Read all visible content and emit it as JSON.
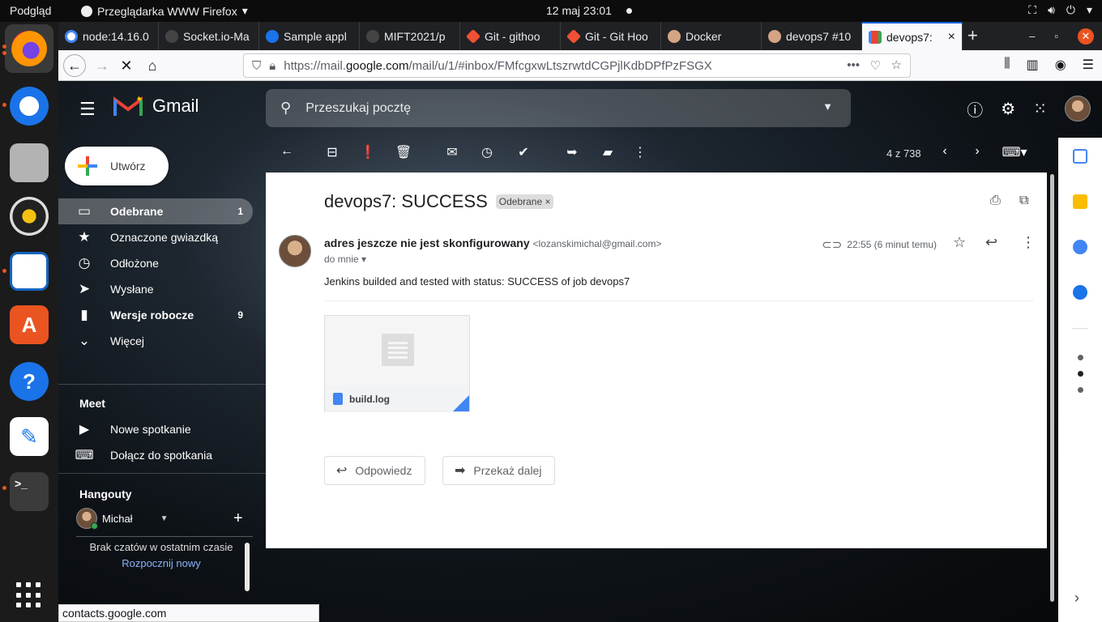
{
  "system": {
    "activity_label": "Podgląd",
    "app_name": "Przeglądarka WWW Firefox",
    "clock": "12 maj  23:01"
  },
  "dock": {
    "items": [
      "firefox",
      "thunderbird",
      "files",
      "rhythmbox",
      "libreoffice-writer",
      "software",
      "help",
      "text-editor",
      "terminal"
    ]
  },
  "browser": {
    "tabs": [
      {
        "title": "node:14.16.0",
        "icon": "google-icon"
      },
      {
        "title": "Socket.io-Ma",
        "icon": "github-icon"
      },
      {
        "title": "Sample appl",
        "icon": "circle-icon"
      },
      {
        "title": "MIFT2021/p",
        "icon": "github-icon"
      },
      {
        "title": "Git - githoo",
        "icon": "git-icon"
      },
      {
        "title": "Git - Git Hoo",
        "icon": "git-icon"
      },
      {
        "title": "Docker",
        "icon": "jenkins-icon"
      },
      {
        "title": "devops7 #10",
        "icon": "jenkins-icon"
      },
      {
        "title": "devops7: ",
        "icon": "gmail-icon"
      }
    ],
    "url_prefix": "https://mail.",
    "url_domain": "google.com",
    "url_path": "/mail/u/1/#inbox/FMfcgxwLtszrwtdCGPjlKdbDPfPzFSGX",
    "status_text": "contacts.google.com"
  },
  "gmail": {
    "logo_text": "Gmail",
    "search_placeholder": "Przeszukaj pocztę",
    "compose_label": "Utwórz",
    "nav": [
      {
        "label": "Odebrane",
        "count": "1",
        "icon": "inbox-icon",
        "active": true
      },
      {
        "label": "Oznaczone gwiazdką",
        "count": "",
        "icon": "star-icon",
        "active": false
      },
      {
        "label": "Odłożone",
        "count": "",
        "icon": "clock-icon",
        "active": false
      },
      {
        "label": "Wysłane",
        "count": "",
        "icon": "send-icon",
        "active": false
      },
      {
        "label": "Wersje robocze",
        "count": "9",
        "icon": "draft-icon",
        "active": false
      },
      {
        "label": "Więcej",
        "count": "",
        "icon": "chevron-down-icon",
        "active": false
      }
    ],
    "meet": {
      "title": "Meet",
      "new_meeting": "Nowe spotkanie",
      "join_meeting": "Dołącz do spotkania"
    },
    "hangouts": {
      "title": "Hangouty",
      "user": "Michał",
      "empty_text": "Brak czatów w ostatnim czasie",
      "start_new": "Rozpocznij nowy"
    },
    "pager": "4 z 738",
    "message": {
      "subject": "devops7: SUCCESS",
      "label": "Odebrane",
      "sender_name": "adres jeszcze nie jest skonfigurowany",
      "sender_email": "<lozanskimichal@gmail.com>",
      "to": "do mnie",
      "time": "22:55 (6 minut temu)",
      "body": "Jenkins builded and tested with status: SUCCESS of job devops7",
      "attachment": "build.log",
      "reply_label": "Odpowiedz",
      "forward_label": "Przekaż dalej"
    }
  }
}
